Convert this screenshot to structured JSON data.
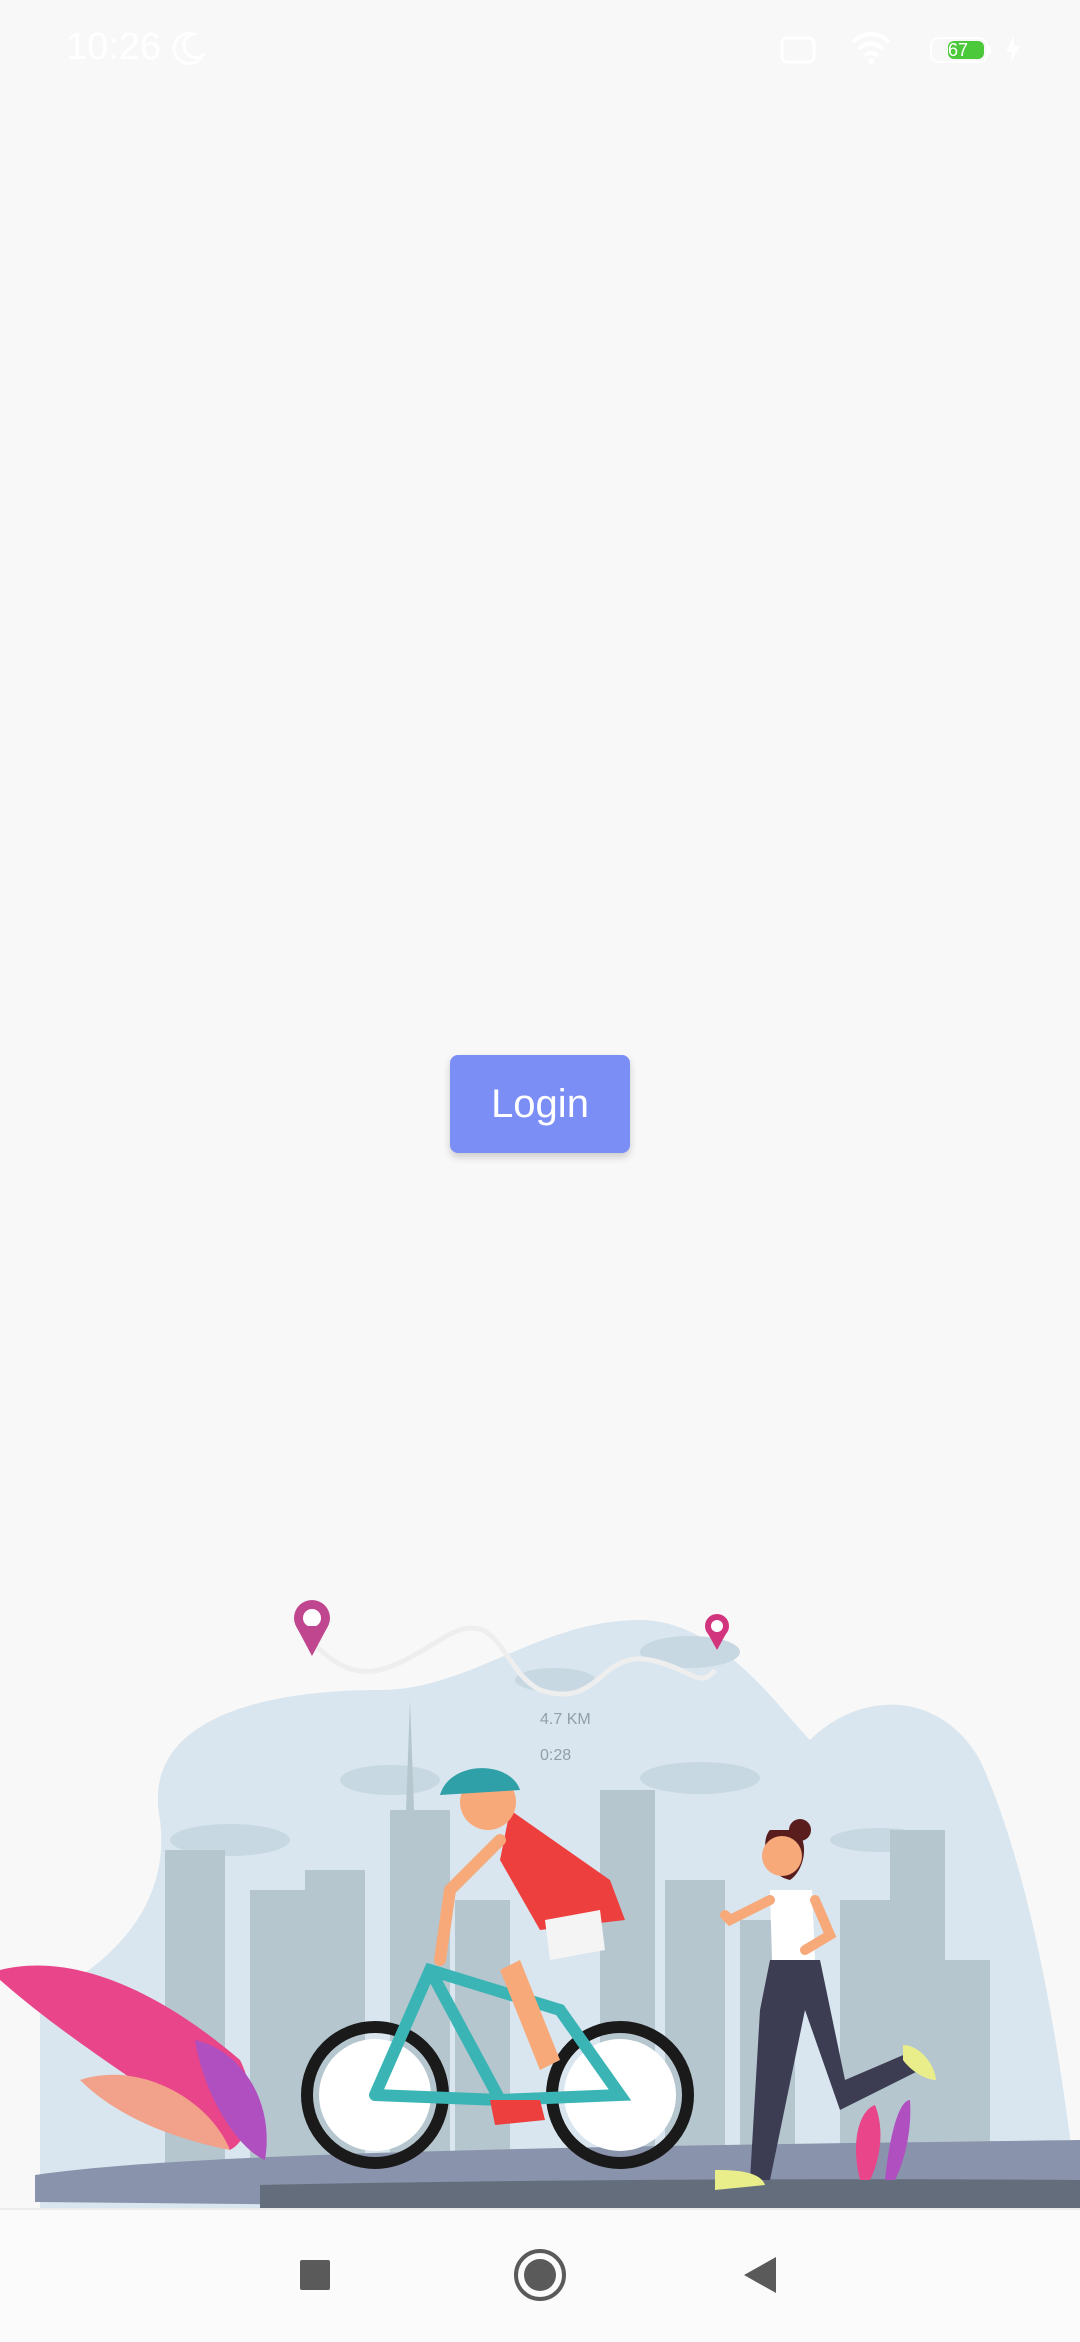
{
  "status_bar": {
    "time": "10:26",
    "battery_level": "67"
  },
  "main": {
    "login_label": "Login"
  },
  "illustration": {
    "distance_label": "4.7 KM",
    "time_label": "0:28"
  },
  "colors": {
    "accent": "#7b8ef6",
    "sky": "#d9e6ef",
    "road": "#8a93ac"
  },
  "icons": [
    "moon-icon",
    "sim-icon",
    "wifi-icon",
    "battery-icon",
    "recents-icon",
    "home-icon",
    "back-icon"
  ]
}
